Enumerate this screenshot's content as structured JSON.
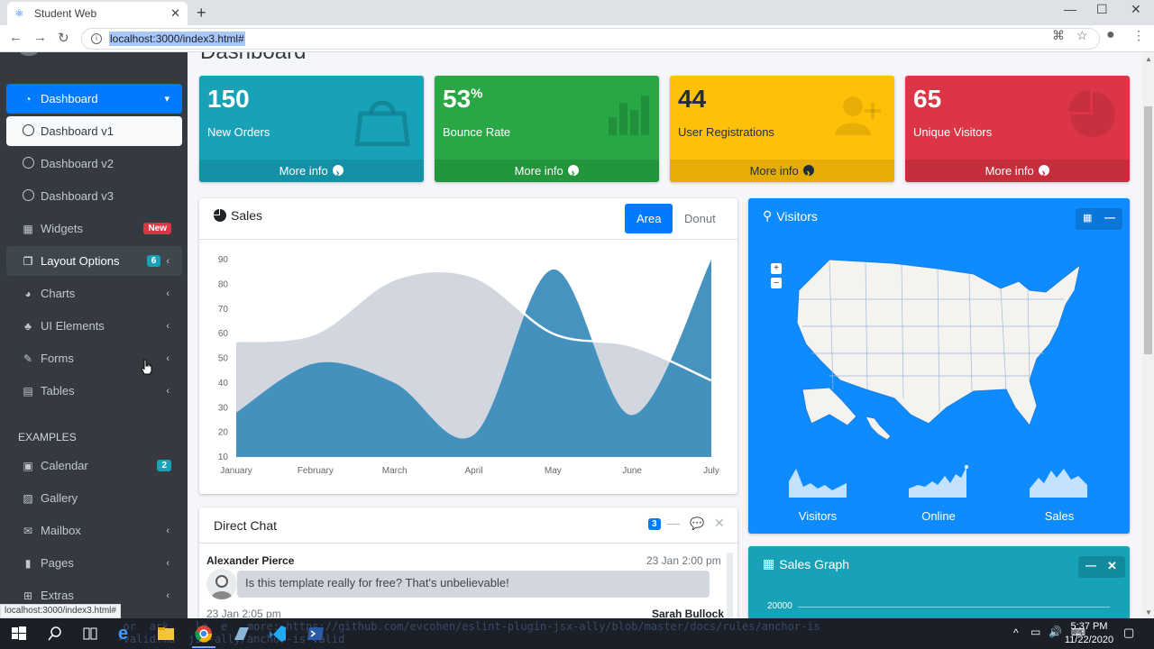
{
  "browser": {
    "tab_title": "Student Web",
    "url": "localhost:3000/index3.html#",
    "status_link": "localhost:3000/index3.html#"
  },
  "sidebar": {
    "items": [
      {
        "label": "Dashboard",
        "icon": "tachometer-icon"
      },
      {
        "label": "Dashboard v1",
        "icon": "circle-icon"
      },
      {
        "label": "Dashboard v2",
        "icon": "circle-icon"
      },
      {
        "label": "Dashboard v3",
        "icon": "circle-icon"
      },
      {
        "label": "Widgets",
        "icon": "th-icon",
        "badge": "New"
      },
      {
        "label": "Layout Options",
        "icon": "copy-icon",
        "badge": "6"
      },
      {
        "label": "Charts",
        "icon": "pie-chart-icon"
      },
      {
        "label": "UI Elements",
        "icon": "tree-icon"
      },
      {
        "label": "Forms",
        "icon": "edit-icon"
      },
      {
        "label": "Tables",
        "icon": "table-icon"
      }
    ],
    "header": "EXAMPLES",
    "examples": [
      {
        "label": "Calendar",
        "icon": "calendar-icon",
        "badge": "2"
      },
      {
        "label": "Gallery",
        "icon": "image-icon"
      },
      {
        "label": "Mailbox",
        "icon": "envelope-icon"
      },
      {
        "label": "Pages",
        "icon": "book-icon"
      },
      {
        "label": "Extras",
        "icon": "plus-square-icon"
      }
    ]
  },
  "stats": [
    {
      "value": "150",
      "label": "New Orders",
      "more": "More info",
      "color": "#17a2b8",
      "icon": "shopping-bag-icon"
    },
    {
      "value": "53",
      "suffix": "%",
      "label": "Bounce Rate",
      "more": "More info",
      "color": "#28a745",
      "icon": "bar-chart-icon"
    },
    {
      "value": "44",
      "label": "User Registrations",
      "more": "More info",
      "color": "#ffc107",
      "icon": "user-plus-icon"
    },
    {
      "value": "65",
      "label": "Unique Visitors",
      "more": "More info",
      "color": "#dc3545",
      "icon": "pie-chart-icon"
    }
  ],
  "sales": {
    "title": "Sales",
    "tab_area": "Area",
    "tab_donut": "Donut"
  },
  "chart_data": {
    "type": "area",
    "categories": [
      "January",
      "February",
      "March",
      "April",
      "May",
      "June",
      "July"
    ],
    "ylim": [
      10,
      90
    ],
    "yticks": [
      90,
      80,
      70,
      60,
      50,
      40,
      30,
      20,
      10
    ],
    "series": [
      {
        "values": [
          57,
          60,
          82,
          83,
          60,
          55,
          41
        ],
        "color": "#d2d6de"
      },
      {
        "values": [
          28,
          48,
          40,
          19,
          86,
          27,
          90
        ],
        "color": "#3c8dbc"
      }
    ]
  },
  "visitors": {
    "title": "Visitors",
    "zoom_in": "+",
    "zoom_out": "–",
    "sparks": [
      "Visitors",
      "Online",
      "Sales"
    ]
  },
  "chat": {
    "title": "Direct Chat",
    "count": "3",
    "messages": [
      {
        "name": "Alexander Pierce",
        "time": "23 Jan 2:00 pm",
        "text": "Is this template really for free? That's unbelievable!"
      },
      {
        "name": "Sarah Bullock",
        "time": "23 Jan 2:05 pm"
      }
    ]
  },
  "sales_graph": {
    "title": "Sales Graph",
    "tick": "20000"
  },
  "taskbar": {
    "time": "5:37 PM",
    "date": "11/22/2020",
    "ghost_line1": "   or  ark    le  e   more: https://github.com/evcohen/eslint-plugin-jsx-ally/blob/master/docs/rules/anchor-is",
    "ghost_line2": "  -valid.md  jsx-ally/anchor-is-valid"
  }
}
